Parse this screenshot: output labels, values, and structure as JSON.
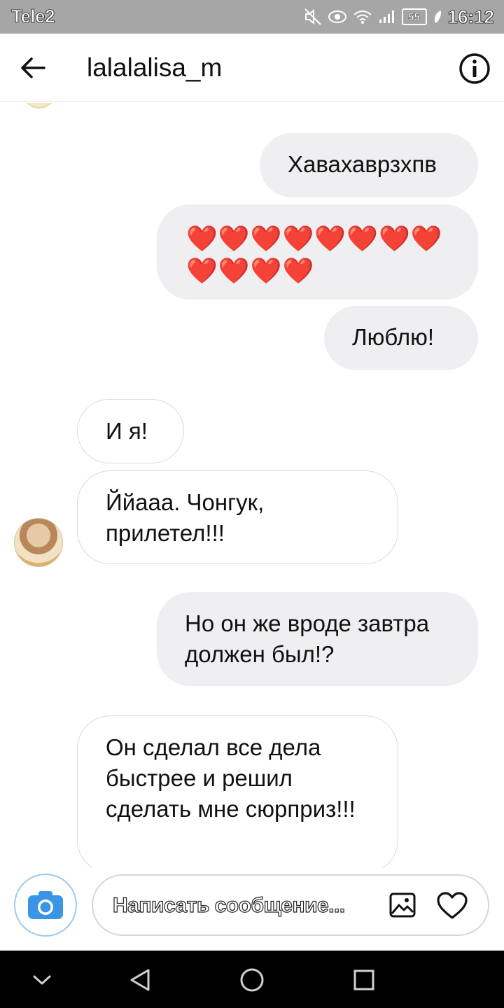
{
  "status_bar": {
    "carrier": "Tele2",
    "battery_level": "55",
    "time": "16:12",
    "icons": [
      "mute-icon",
      "eye-icon",
      "wifi-icon",
      "signal-icon",
      "battery-icon",
      "leaf-icon"
    ]
  },
  "header": {
    "title": "lalalalisa_m",
    "back_icon": "arrow-left-icon",
    "info_icon": "info-icon"
  },
  "messages": [
    {
      "direction": "outgoing",
      "text": "Хавахаврзхпв"
    },
    {
      "direction": "outgoing",
      "text": "❤️❤️❤️❤️❤️❤️❤️❤️❤️❤️❤️❤️"
    },
    {
      "direction": "outgoing",
      "text": "Люблю!"
    },
    {
      "direction": "incoming",
      "text": "И я!"
    },
    {
      "direction": "incoming",
      "text": "Ййааа. Чонгук, прилетел!!!"
    },
    {
      "direction": "outgoing",
      "text": "Но он же вроде завтра должен был!?"
    },
    {
      "direction": "incoming",
      "text": "Он сделал все дела быстрее и решил сделать мне сюрприз!!!"
    }
  ],
  "composer": {
    "placeholder": "Написать сообщение...",
    "camera_icon": "camera-icon",
    "gallery_icon": "image-icon",
    "like_icon": "heart-icon"
  },
  "navigation": {
    "buttons": [
      "chevron-down-icon",
      "back-triangle-icon",
      "home-circle-icon",
      "recents-square-icon"
    ]
  },
  "colors": {
    "outgoing_bubble": "#efeef1",
    "incoming_border": "#d9d9d9",
    "status_bar": "#a6a6a6",
    "camera_accent": "#3b95e6",
    "heart": "#d61f2c"
  }
}
